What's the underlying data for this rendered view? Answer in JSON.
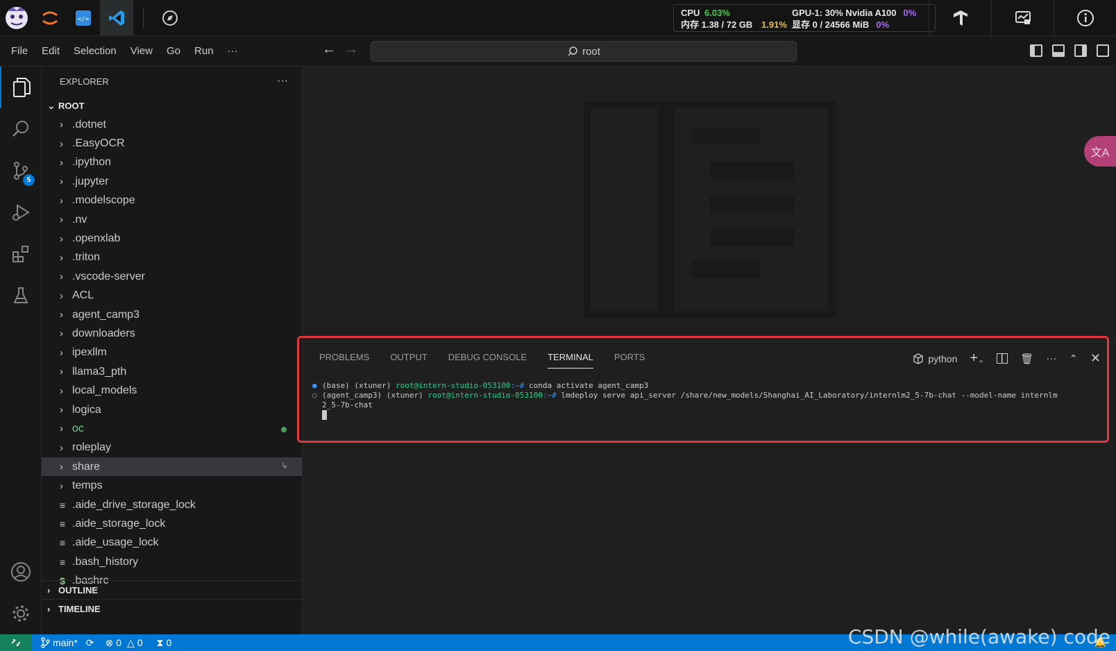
{
  "stats": {
    "cpu_label": "CPU",
    "cpu_value": "6.03%",
    "gpu_label": "GPU-1: 30% Nvidia A100",
    "gpu_value": "0%",
    "mem_label": "内存 1.38 / 72 GB",
    "mem_value": "1.91%",
    "vram_label": "显存 0 / 24566 MiB",
    "vram_value": "0%"
  },
  "menu": [
    "File",
    "Edit",
    "Selection",
    "View",
    "Go",
    "Run",
    "···"
  ],
  "search": {
    "text": "root"
  },
  "explorer": {
    "title": "EXPLORER",
    "more": "···",
    "root": "ROOT",
    "folders": [
      ".dotnet",
      ".EasyOCR",
      ".ipython",
      ".jupyter",
      ".modelscope",
      ".nv",
      ".openxlab",
      ".triton",
      ".vscode-server",
      "ACL",
      "agent_camp3",
      "downloaders",
      "ipexllm",
      "llama3_pth",
      "local_models",
      "logica",
      "oc",
      "roleplay",
      "share",
      "temps"
    ],
    "files": [
      ".aide_drive_storage_lock",
      ".aide_storage_lock",
      ".aide_usage_lock",
      ".bash_history",
      ".bashrc"
    ],
    "outline": "OUTLINE",
    "timeline": "TIMELINE"
  },
  "scm_badge": "5",
  "panel": {
    "tabs": [
      "PROBLEMS",
      "OUTPUT",
      "DEBUG CONSOLE",
      "TERMINAL",
      "PORTS"
    ],
    "active_tab": "TERMINAL",
    "shell": "python"
  },
  "terminal": {
    "line1_env": "(base) (xtuner) ",
    "line1_user": "root@intern-studio-053100",
    "line1_path": ":~#",
    "line1_cmd": " conda activate agent_camp3",
    "line2_env": "(agent_camp3) (xtuner) ",
    "line2_user": "root@intern-studio-053100",
    "line2_path": ":~#",
    "line2_cmd": " lmdeploy serve api_server /share/new_models/Shanghai_AI_Laboratory/internlm2_5-7b-chat --model-name internlm",
    "line3": "2_5-7b-chat"
  },
  "status": {
    "branch": "main*",
    "errors": "0",
    "warnings": "0",
    "ports": "0"
  },
  "watermark": "CSDN @while(awake) code",
  "colors": {
    "accent": "#0078d4",
    "highlight": "#e0383e",
    "remote": "#16825d"
  }
}
